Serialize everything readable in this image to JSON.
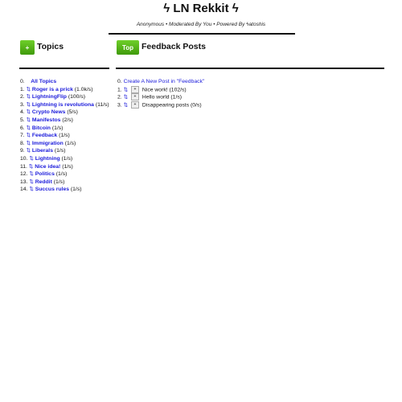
{
  "header": {
    "title": "ϟ LN Rekkit ϟ",
    "subtitle": "Anonymous • Moderated By You • Powered By ϟatoshis"
  },
  "topics": {
    "add_label": "+",
    "heading": "Topics",
    "all": {
      "num": "0.",
      "label": "All Topics"
    },
    "items": [
      {
        "num": "1.",
        "label": "Roger is a prick",
        "rate": "(1.0k/s)"
      },
      {
        "num": "2.",
        "label": "LightningFlip",
        "rate": "(100/s)"
      },
      {
        "num": "3.",
        "label": "Lightning is revolutiona",
        "rate": "(11/s)"
      },
      {
        "num": "4.",
        "label": "Crypto News",
        "rate": "(5/s)"
      },
      {
        "num": "5.",
        "label": "Manifestos",
        "rate": "(2/s)"
      },
      {
        "num": "6.",
        "label": "Bitcoin",
        "rate": "(1/s)"
      },
      {
        "num": "7.",
        "label": "Feedback",
        "rate": "(1/s)"
      },
      {
        "num": "8.",
        "label": "Immigration",
        "rate": "(1/s)"
      },
      {
        "num": "9.",
        "label": "Liberals",
        "rate": "(1/s)"
      },
      {
        "num": "10.",
        "label": "Lightning",
        "rate": "(1/s)"
      },
      {
        "num": "11.",
        "label": "Nice idea!",
        "rate": "(1/s)"
      },
      {
        "num": "12.",
        "label": "Politics",
        "rate": "(1/s)"
      },
      {
        "num": "13.",
        "label": "Reddit",
        "rate": "(1/s)"
      },
      {
        "num": "14.",
        "label": "Succus rules",
        "rate": "(1/s)"
      }
    ]
  },
  "posts": {
    "sort_label": "Top",
    "heading": "Feedback Posts",
    "create": {
      "num": "0.",
      "label": "Create A New Post in \"Feedback\""
    },
    "items": [
      {
        "num": "1.",
        "label": "Nice work!",
        "rate": "(102/s)"
      },
      {
        "num": "2.",
        "label": "Hello world",
        "rate": "(1/s)"
      },
      {
        "num": "3.",
        "label": "Disappearing posts",
        "rate": "(0/s)"
      }
    ]
  },
  "icons": {
    "vote": "⇅",
    "expand": "+"
  },
  "colors": {
    "accent": "#4caf14",
    "link": "#1a1adb"
  }
}
